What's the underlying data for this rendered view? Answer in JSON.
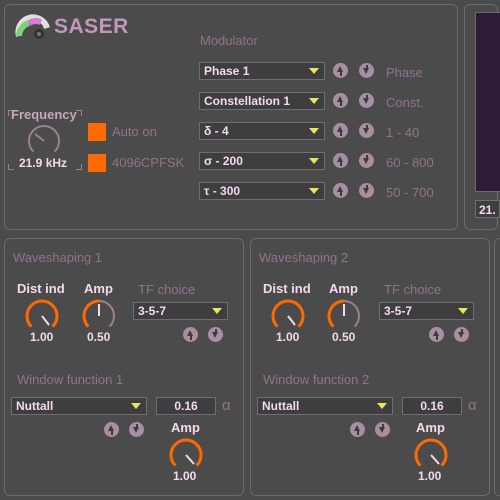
{
  "app": {
    "title": "SASER"
  },
  "modulator": {
    "title": "Modulator",
    "rows": [
      {
        "value": "Phase 1",
        "label": "Phase"
      },
      {
        "value": "Constellation 1",
        "label": "Const."
      },
      {
        "value": "δ - 4",
        "label": "1 - 40"
      },
      {
        "value": "σ - 200",
        "label": "60 - 800"
      },
      {
        "value": "τ - 300",
        "label": "50 - 700"
      }
    ]
  },
  "frequency": {
    "label": "Frequency",
    "value": "21.9 kHz"
  },
  "toggles": {
    "auto_on": "Auto on",
    "mode": "4096CPFSK"
  },
  "display": {
    "readout": "21."
  },
  "waveshaping1": {
    "title": "Waveshaping 1",
    "dist_label": "Dist ind",
    "dist_value": "1.00",
    "amp_label": "Amp",
    "amp_value": "0.50",
    "tf_label": "TF choice",
    "tf_value": "3-5-7",
    "window_label": "Window function 1",
    "window_value": "Nuttall",
    "alpha_value": "0.16",
    "alpha_symbol": "α",
    "amp2_label": "Amp",
    "amp2_value": "1.00"
  },
  "waveshaping2": {
    "title": "Waveshaping 2",
    "dist_label": "Dist ind",
    "dist_value": "1.00",
    "amp_label": "Amp",
    "amp_value": "0.50",
    "tf_label": "TF choice",
    "tf_value": "3-5-7",
    "window_label": "Window function 2",
    "window_value": "Nuttall",
    "alpha_value": "0.16",
    "alpha_symbol": "α",
    "amp2_label": "Amp",
    "amp2_value": "1.00"
  },
  "colors": {
    "accent": "#ff6a00",
    "arrow": "#e8e65a",
    "label": "#8f738a",
    "value": "#f4d9ec"
  }
}
